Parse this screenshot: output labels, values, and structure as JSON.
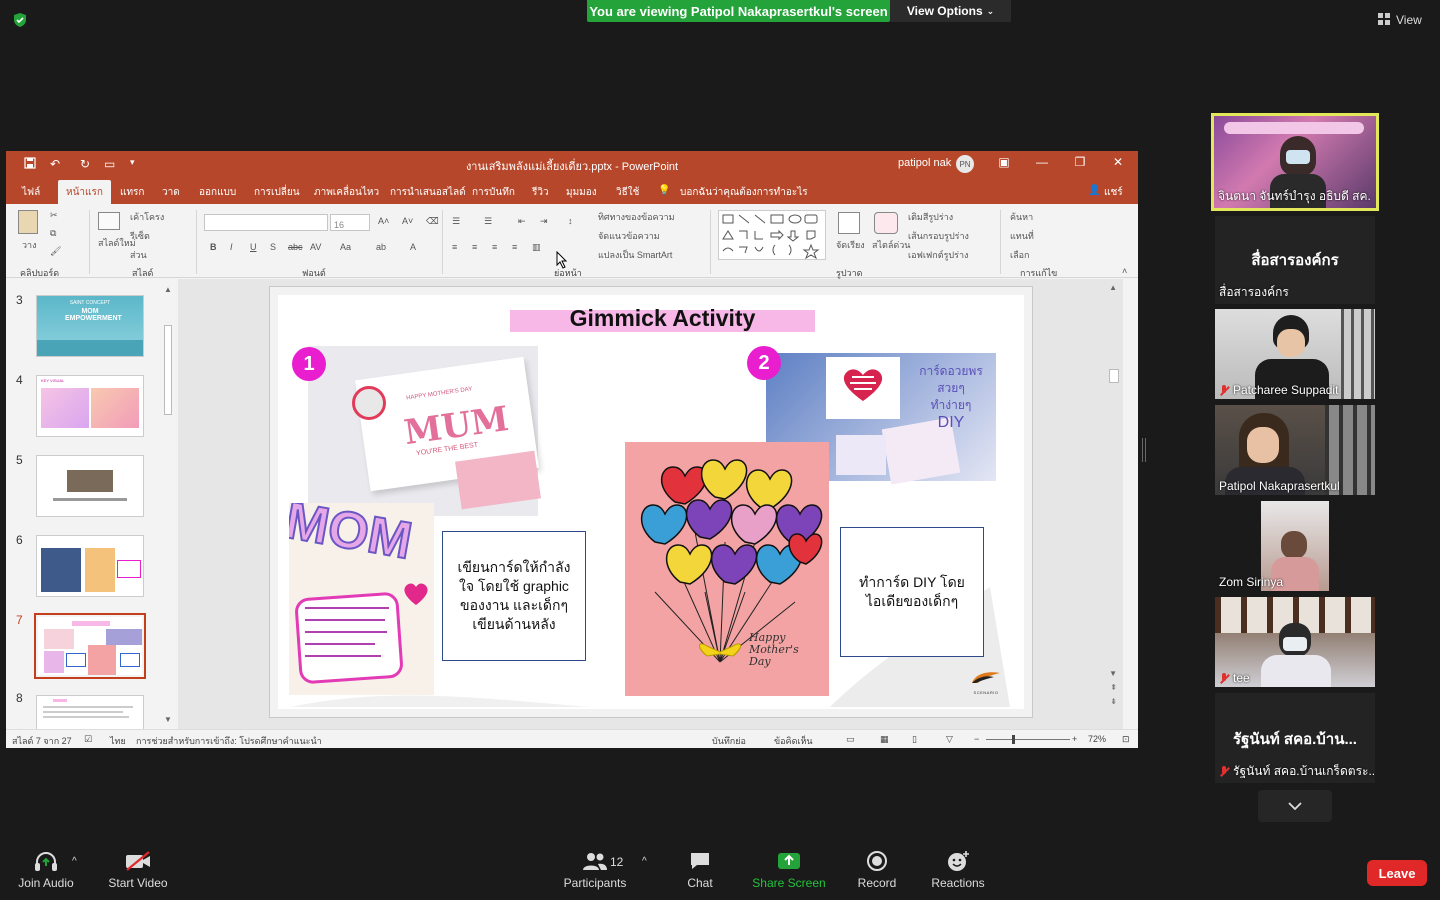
{
  "zoom": {
    "share_banner": "You are viewing Patipol Nakaprasertkul's screen",
    "view_options": "View Options",
    "view": "View",
    "leave": "Leave",
    "participants_count": "12",
    "toolbar": {
      "join_audio": "Join Audio",
      "start_video": "Start Video",
      "participants": "Participants",
      "chat": "Chat",
      "share_screen": "Share Screen",
      "record": "Record",
      "reactions": "Reactions"
    },
    "tiles": {
      "t1_name": "จินตนา จันทร์บำรุง อธิบดี สค.",
      "t2_big": "สื่อสารองค์กร",
      "t2_name": "สื่อสารองค์กร",
      "t3_name": "Patcharee Suppadit",
      "t4_name": "Patipol Nakaprasertkul",
      "t5_name": "Zom Sirinya",
      "t6_name": "tee",
      "t7_big": "รัฐนันท์ สคอ.บ้าน...",
      "t7_name": "รัฐนันท์ สคอ.บ้านเกร็ดตระ..."
    }
  },
  "ppt": {
    "filename": "งานเสริมพลังแม่เลี้ยงเดี่ยว.pptx - PowerPoint",
    "user": "patipol nak",
    "user_initials": "PN",
    "tabs": [
      "ไฟล์",
      "หน้าแรก",
      "แทรก",
      "วาด",
      "ออกแบบ",
      "การเปลี่ยน",
      "ภาพเคลื่อนไหว",
      "การนำเสนอสไลด์",
      "การบันทึก",
      "รีวิว",
      "มุมมอง",
      "วิธีใช้"
    ],
    "tellme": "บอกฉันว่าคุณต้องการทำอะไร",
    "share": "แชร์",
    "ribbon": {
      "paste": "วาง",
      "clipboard": "คลิปบอร์ด",
      "new_slide": "สไลด์ใหม่",
      "layout": "เค้าโครง",
      "reset": "รีเซ็ต",
      "section": "ส่วน",
      "slides": "สไลด์",
      "font_group": "ฟอนต์",
      "font_size": "16",
      "text_dir": "ทิศทางของข้อความ",
      "align_text": "จัดแนวข้อความ",
      "smartart": "แปลงเป็น SmartArt",
      "paragraph": "ย่อหน้า",
      "arrange": "จัดเรียง",
      "quick_styles": "สไตล์ด่วน",
      "drawing": "รูปวาด",
      "shape_fill": "เติมสีรูปร่าง",
      "shape_outline": "เส้นกรอบรูปร่าง",
      "shape_effects": "เอฟเฟกต์รูปร่าง",
      "find": "ค้นหา",
      "replace": "แทนที่",
      "select": "เลือก",
      "editing": "การแก้ไข"
    },
    "thumbs": [
      {
        "num": "3",
        "text": "MOM EMPOWERMENT",
        "sub": "SAINT CONCEPT"
      },
      {
        "num": "4",
        "text": "KEY VISUAL"
      },
      {
        "num": "5",
        "text": ""
      },
      {
        "num": "6",
        "text": ""
      },
      {
        "num": "7",
        "text": "Gimmick Activity"
      },
      {
        "num": "8",
        "text": ""
      }
    ],
    "slide": {
      "title": "Gimmick Activity",
      "badge1": "1",
      "badge2": "2",
      "card1_line1": "HAPPY MOTHER'S DAY",
      "card1_mum": "MUM",
      "card1_line2": "YOU'RE THE BEST",
      "card2_text1": "การ์ดอวยพร",
      "card2_text2": "สวยๆ",
      "card2_text3": "ทำง่ายๆ",
      "card2_text4": "DIY",
      "mom_letters": "MOM",
      "balloon_text": "Happy Mother's Day",
      "box1": "เขียนการ์ดให้กำลังใจ โดยใช้ graphic ของงาน และเด็กๆ เขียนด้านหลัง",
      "box2": "ทำการ์ด DIY โดย ไอเดียของเด็กๆ",
      "logo_text": "SCENARIO"
    },
    "status": {
      "slide_of": "สไลด์ 7 จาก 27",
      "language": "ไทย",
      "accessibility": "การช่วยสำหรับการเข้าถึง: โปรดศึกษาคำแนะนำ",
      "notes": "บันทึกย่อ",
      "comments": "ข้อคิดเห็น",
      "zoom": "72%"
    }
  },
  "colors": {
    "ppt_red": "#b7472a",
    "zoom_green": "#23a33a",
    "leave_red": "#e02828",
    "title_pink": "#f7b8e8",
    "badge_magenta": "#e91ecf"
  }
}
